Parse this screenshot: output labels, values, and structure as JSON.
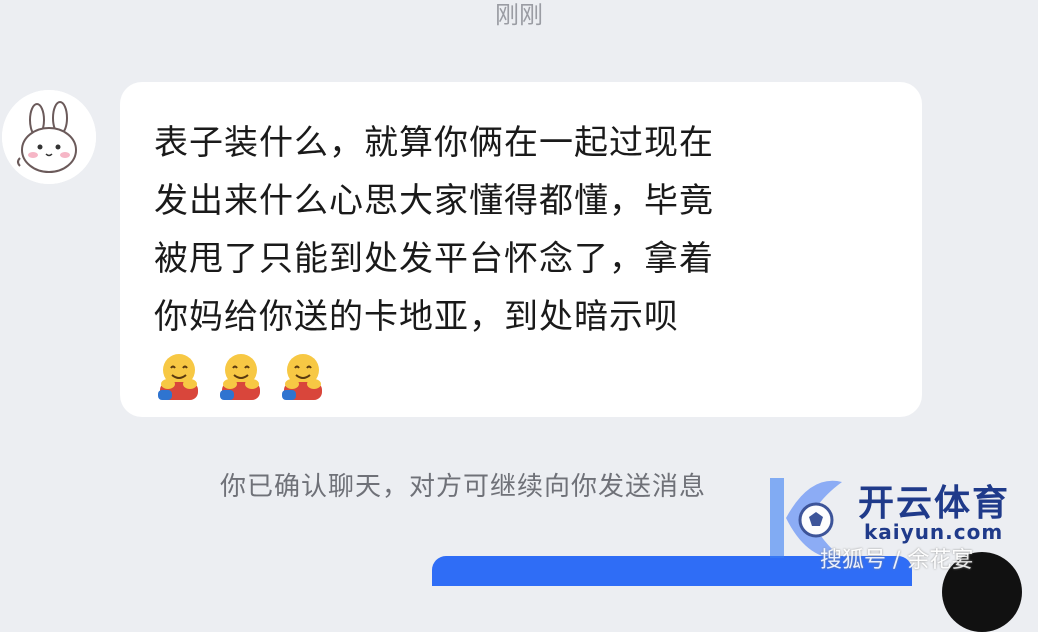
{
  "chat": {
    "timestamp": "刚刚",
    "message": {
      "lines": [
        "表子装什么，就算你俩在一起过现在",
        "发出来什么心思大家懂得都懂，毕竟",
        "被甩了只能到处发平台怀念了，拿着",
        "你妈给你送的卡地亚，到处暗示呗"
      ],
      "emojis": [
        "hugging-face-icon",
        "hugging-face-icon",
        "hugging-face-icon"
      ]
    },
    "system_notice": "你已确认聊天，对方可继续向你发送消息"
  },
  "watermark": {
    "name": "开云体育",
    "domain": "kaiyun.com",
    "sub": "搜狐号 / 余花宴"
  },
  "colors": {
    "background": "#eceef2",
    "bubble": "#ffffff",
    "accent_blue": "#2f6df6",
    "watermark_blue": "#1f3a8a"
  }
}
